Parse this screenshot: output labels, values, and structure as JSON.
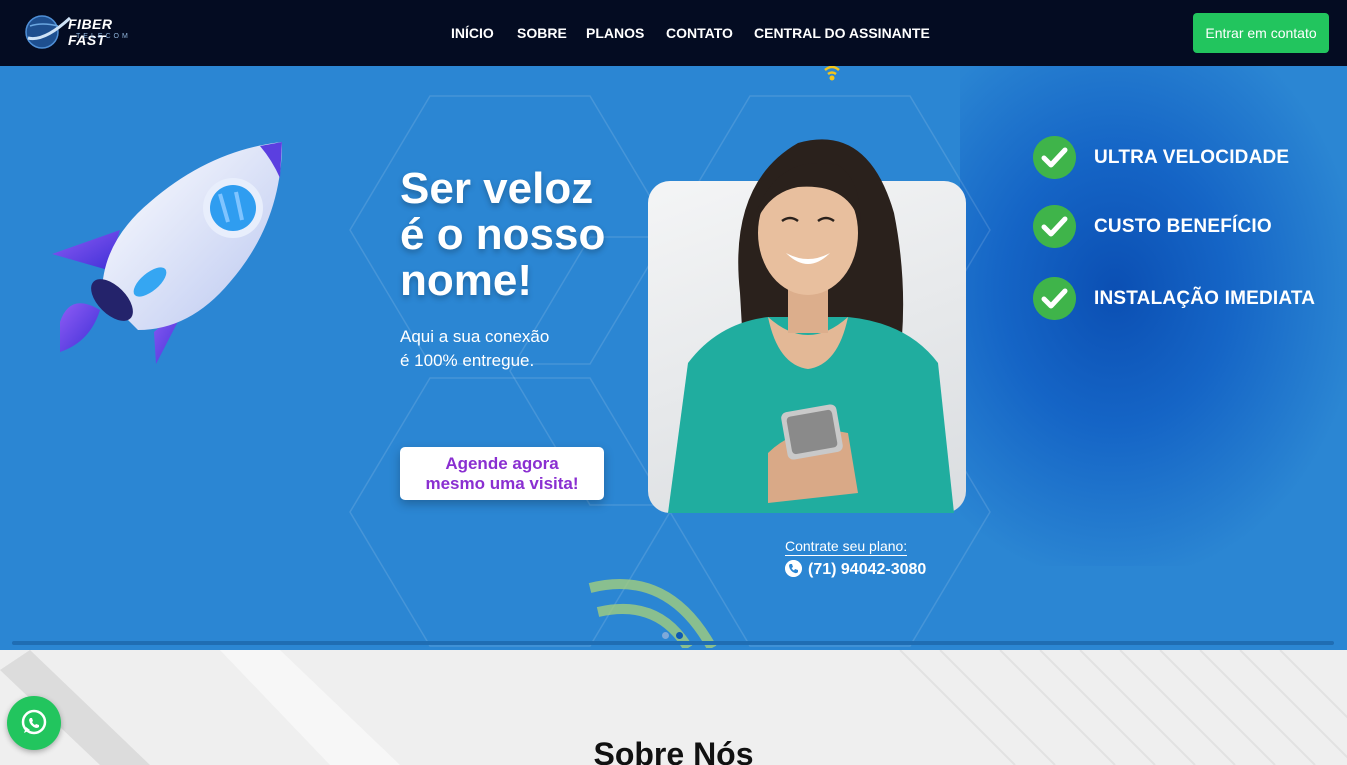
{
  "header": {
    "logo": {
      "name": "FIBER FAST",
      "sub": "TELECOM"
    },
    "nav": [
      {
        "label": "INÍCIO"
      },
      {
        "label": "SOBRE"
      },
      {
        "label": "PLANOS"
      },
      {
        "label": "CONTATO"
      },
      {
        "label": "CENTRAL DO ASSINANTE"
      }
    ],
    "contact_button": "Entrar em contato"
  },
  "hero": {
    "headline": [
      "Ser veloz",
      "é o nosso",
      "nome!"
    ],
    "subtitle": [
      "Aqui a sua conexão",
      "é 100% entregue."
    ],
    "cta": [
      "Agende agora",
      "mesmo uma visita!"
    ],
    "benefits": [
      {
        "label": "ULTRA VELOCIDADE",
        "icon": "check-icon"
      },
      {
        "label": "CUSTO BENEFÍCIO",
        "icon": "check-icon"
      },
      {
        "label": "INSTALAÇÃO IMEDIATA",
        "icon": "check-icon"
      }
    ],
    "plan_label": "Contrate seu plano:",
    "phone": "(71) 94042-3080"
  },
  "about": {
    "title": "Sobre Nós"
  },
  "colors": {
    "header_bg": "#040c22",
    "hero_bg": "#2b86d3",
    "accent_green": "#22c55e",
    "cta_text": "#8a2fd1",
    "check_green": "#3fb44a"
  }
}
